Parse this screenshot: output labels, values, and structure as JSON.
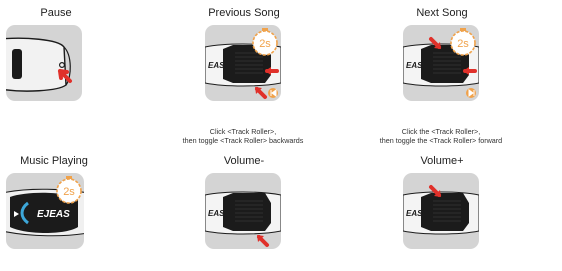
{
  "panels": [
    {
      "id": "pause",
      "title": "Pause"
    },
    {
      "id": "previous",
      "title": "Previous Song",
      "caption_lines": [
        "Click <Track Roller>,",
        "then toggle <Track Roller> backwards"
      ]
    },
    {
      "id": "next",
      "title": "Next Song",
      "caption_lines": [
        "Click the <Track Roller>,",
        "then toggle the <Track Roller> forward"
      ]
    },
    {
      "id": "music",
      "title": "Music Playing"
    },
    {
      "id": "volume-down",
      "title": "Volume-"
    },
    {
      "id": "volume-up",
      "title": "Volume+"
    }
  ],
  "timer_label": "2s",
  "brand": "EJEAS",
  "brand_short": "EAS",
  "colors": {
    "arrow": "#e0302a",
    "timer": "#f0a24b",
    "card": "#d4d4d4",
    "device": "#1b1b1b"
  },
  "icons": [
    "red-arrow-icon",
    "stopwatch-icon",
    "skip-previous-icon",
    "skip-next-icon",
    "bluetooth-ring"
  ]
}
